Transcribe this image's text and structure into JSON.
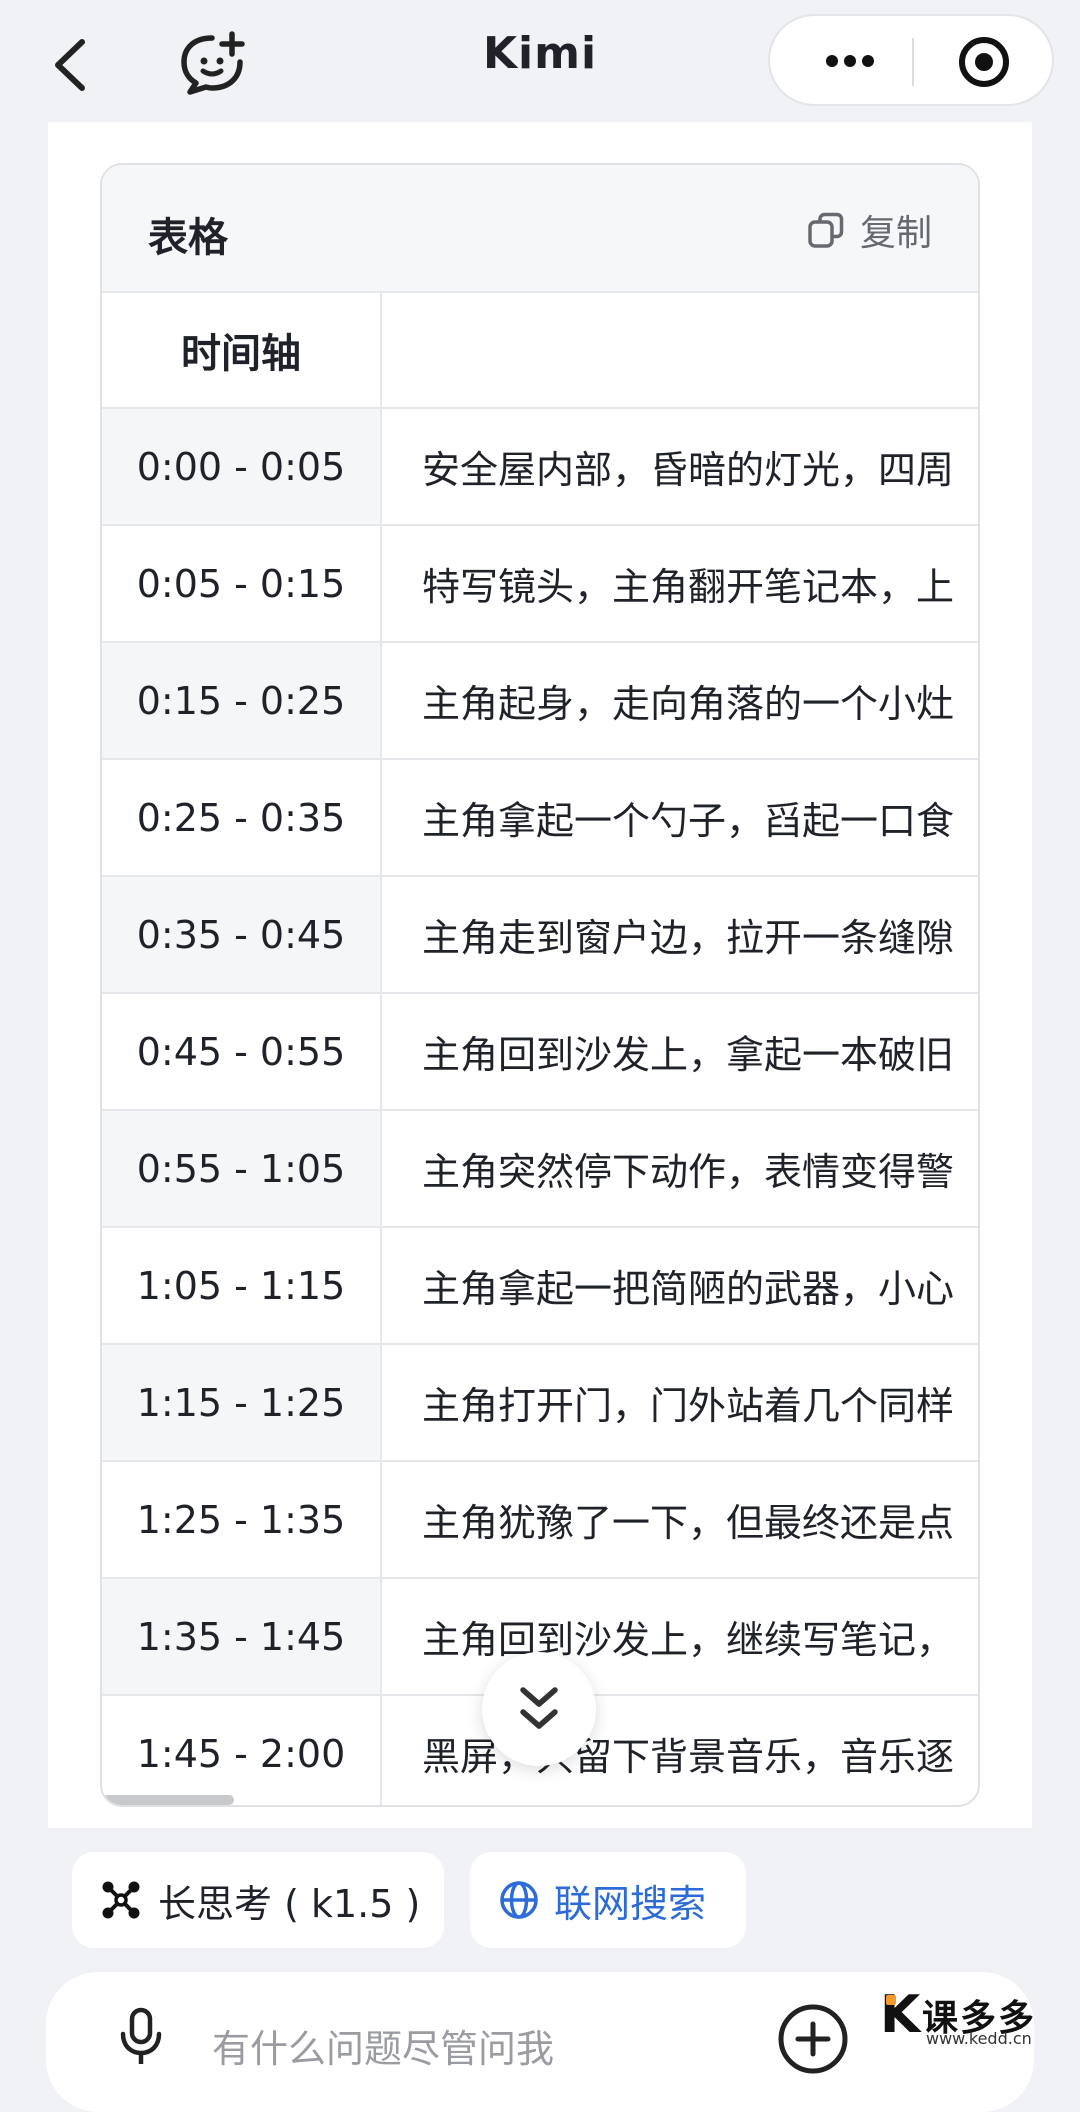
{
  "header": {
    "title": "Kimi",
    "back_icon": "chevron-left-icon",
    "new_chat_icon": "chat-add-icon",
    "more_icon": "more-dots-icon",
    "close_icon": "target-close-icon"
  },
  "table_card": {
    "title": "表格",
    "copy_label": "复制",
    "columns": [
      "时间轴",
      ""
    ],
    "rows": [
      {
        "time": "0:00 - 0:05",
        "desc": "安全屋内部，昏暗的灯光，四周"
      },
      {
        "time": "0:05 - 0:15",
        "desc": "特写镜头，主角翻开笔记本，上"
      },
      {
        "time": "0:15 - 0:25",
        "desc": "主角起身，走向角落的一个小灶"
      },
      {
        "time": "0:25 - 0:35",
        "desc": "主角拿起一个勺子，舀起一口食"
      },
      {
        "time": "0:35 - 0:45",
        "desc": "主角走到窗户边，拉开一条缝隙"
      },
      {
        "time": "0:45 - 0:55",
        "desc": "主角回到沙发上，拿起一本破旧"
      },
      {
        "time": "0:55 - 1:05",
        "desc": "主角突然停下动作，表情变得警"
      },
      {
        "time": "1:05 - 1:15",
        "desc": "主角拿起一把简陋的武器，小心"
      },
      {
        "time": "1:15 - 1:25",
        "desc": "主角打开门，门外站着几个同样"
      },
      {
        "time": "1:25 - 1:35",
        "desc": "主角犹豫了一下，但最终还是点"
      },
      {
        "time": "1:35 - 1:45",
        "desc": "主角回到沙发上，继续写笔记，"
      },
      {
        "time": "1:45 - 2:00",
        "desc": "黑屏，只留下背景音乐，音乐逐"
      }
    ]
  },
  "chips": {
    "think_label": "长思考 ( k1.5 )",
    "search_label": "联网搜索"
  },
  "input": {
    "placeholder": "有什么问题尽管问我"
  },
  "watermark": {
    "brand": "课多多",
    "url": "www.kedd.cn"
  },
  "colors": {
    "accent_blue": "#2d6bd8",
    "background": "#f1f2f5",
    "watermark_orange": "#f29a2e"
  }
}
